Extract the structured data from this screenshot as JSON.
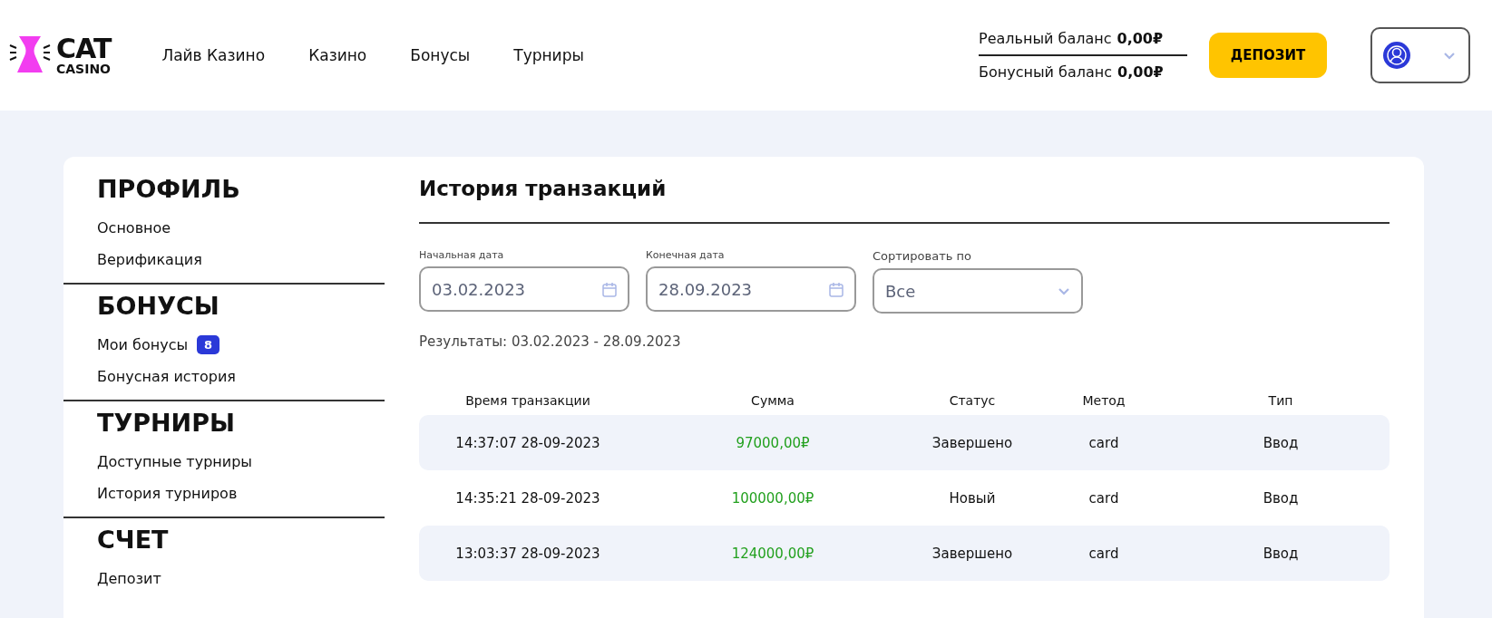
{
  "header": {
    "logo": {
      "line1": "CAT",
      "line2": "CASINO"
    },
    "nav": [
      "Лайв Казино",
      "Казино",
      "Бонусы",
      "Турниры"
    ],
    "balances": [
      {
        "label": "Реальный баланс",
        "value": "0,00₽"
      },
      {
        "label": "Бонусный баланс",
        "value": "0,00₽"
      }
    ],
    "deposit_button": "ДЕПОЗИТ"
  },
  "sidebar": {
    "sections": [
      {
        "title": "ПРОФИЛЬ",
        "items": [
          {
            "label": "Основное"
          },
          {
            "label": "Верификация"
          }
        ]
      },
      {
        "title": "БОНУСЫ",
        "items": [
          {
            "label": "Мои бонусы",
            "badge": "8"
          },
          {
            "label": "Бонусная история"
          }
        ]
      },
      {
        "title": "ТУРНИРЫ",
        "items": [
          {
            "label": "Доступные турниры"
          },
          {
            "label": "История турниров"
          }
        ]
      },
      {
        "title": "СЧЕТ",
        "items": [
          {
            "label": "Депозит"
          }
        ]
      }
    ]
  },
  "main": {
    "title": "История транзакций",
    "filters": [
      {
        "kind": "date",
        "label": "Начальная дата",
        "value": "03.02.2023"
      },
      {
        "kind": "date",
        "label": "Конечная дата",
        "value": "28.09.2023"
      },
      {
        "kind": "select",
        "label": "Сортировать по",
        "value": "Все"
      }
    ],
    "results": "Результаты: 03.02.2023 - 28.09.2023",
    "table": {
      "columns": [
        "Время транзакции",
        "Сумма",
        "Статус",
        "Метод",
        "Тип"
      ],
      "rows": [
        [
          "14:37:07 28-09-2023",
          "97000,00₽",
          "Завершено",
          "card",
          "Ввод"
        ],
        [
          "14:35:21 28-09-2023",
          "100000,00₽",
          "Новый",
          "card",
          "Ввод"
        ],
        [
          "13:03:37 28-09-2023",
          "124000,00₽",
          "Завершено",
          "card",
          "Ввод"
        ]
      ]
    }
  }
}
